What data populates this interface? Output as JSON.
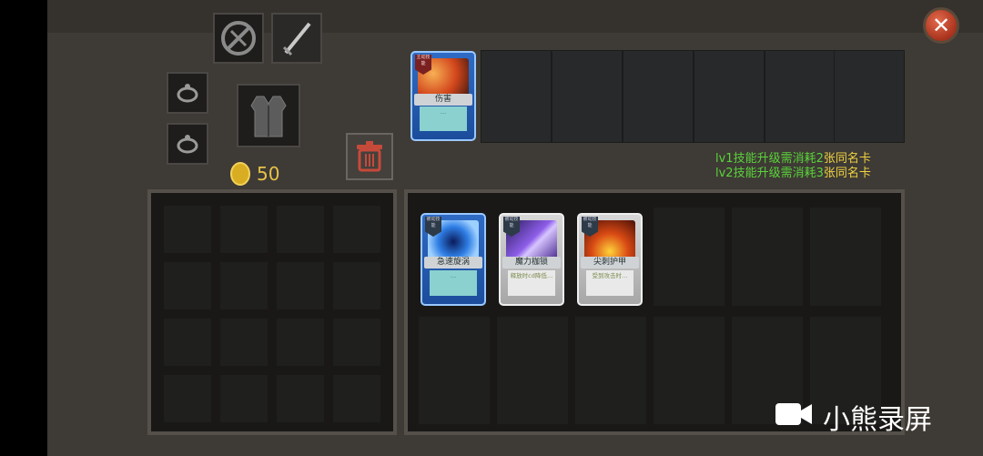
{
  "currency": {
    "amount": "50",
    "icon": "gold-coin-icon"
  },
  "equipment": {
    "weapon_disabled_icon": "crossed-weapon-icon",
    "sword_icon": "sword-icon",
    "ring1_icon": "ring-icon",
    "ring2_icon": "ring-icon",
    "armor_icon": "armor-vest-icon"
  },
  "equipped_skill": {
    "tag": "主动技能",
    "name": "伤害",
    "desc": "…"
  },
  "hints": [
    {
      "prefix": "lv1技能升级需消耗",
      "num": "2",
      "suffix": "张同名卡"
    },
    {
      "prefix": "lv2技能升级需消耗",
      "num": "3",
      "suffix": "张同名卡"
    }
  ],
  "inventory_cards": [
    {
      "tag": "被动技能",
      "name": "急速旋涡",
      "desc": "…",
      "style": "blue"
    },
    {
      "tag": "被动技能",
      "name": "魔力枷锁",
      "desc": "释放时cd降低…",
      "style": "grey"
    },
    {
      "tag": "被动技能",
      "name": "尖刺护甲",
      "desc": "受到攻击时…",
      "style": "grey"
    }
  ],
  "watermark": "小熊录屏",
  "colors": {
    "accent_gold": "#e6c34a",
    "hint_yellow": "#f0d442",
    "hint_green": "#5ad43a",
    "close_red": "#c44a2d"
  }
}
